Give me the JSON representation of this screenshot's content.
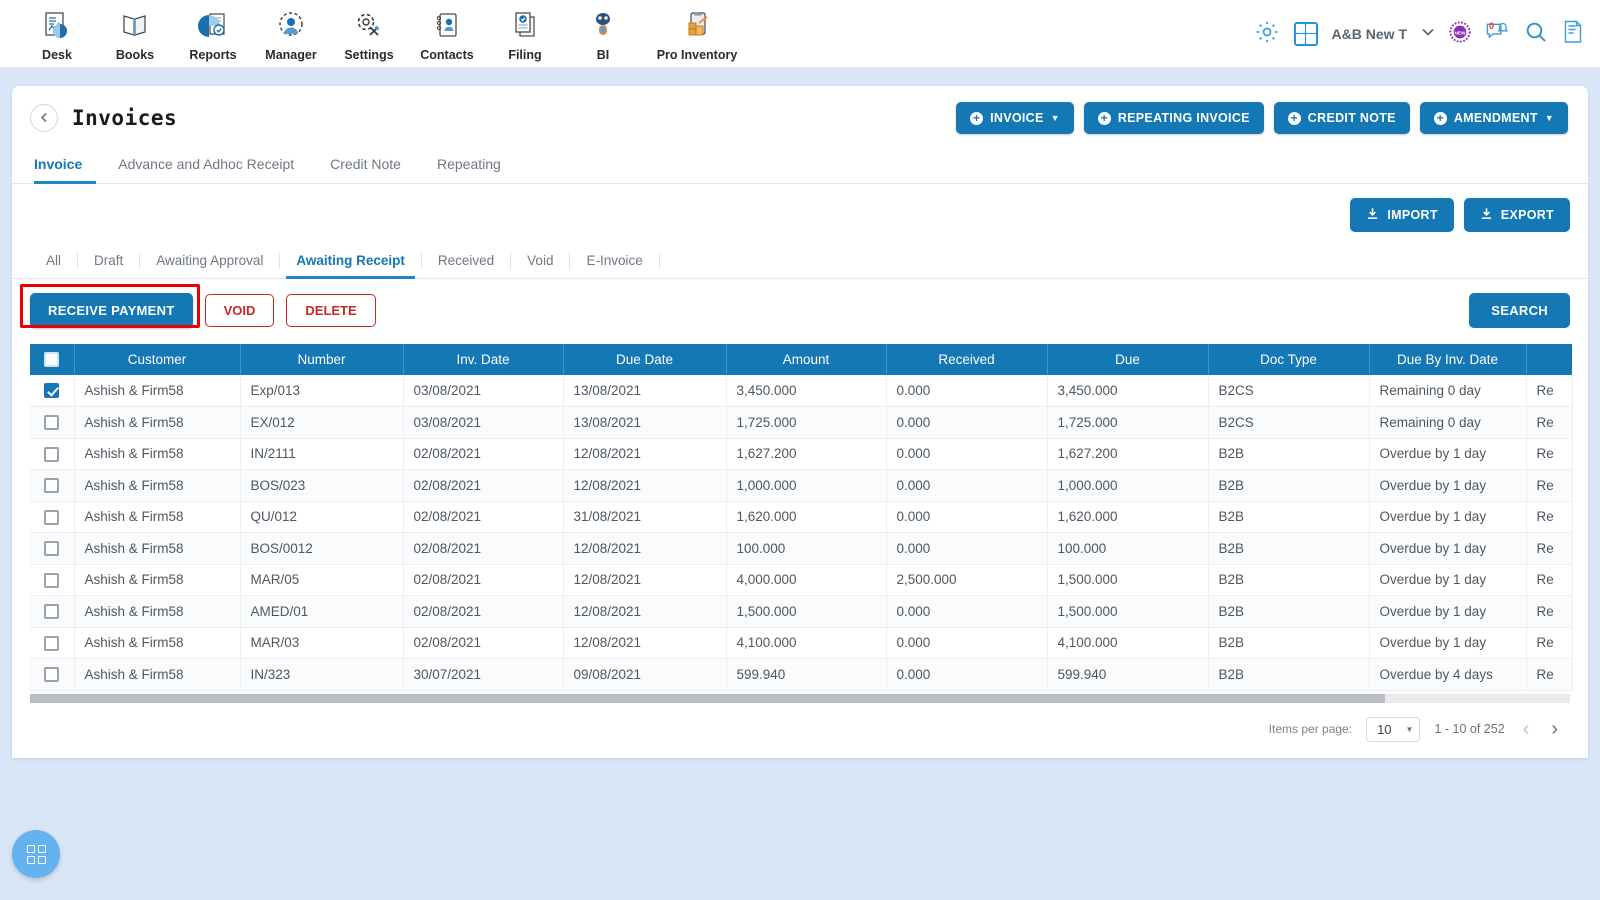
{
  "topnav": {
    "apps": [
      {
        "label": "Desk",
        "icon": "desk-icon"
      },
      {
        "label": "Books",
        "icon": "books-icon"
      },
      {
        "label": "Reports",
        "icon": "reports-icon"
      },
      {
        "label": "Manager",
        "icon": "manager-icon"
      },
      {
        "label": "Settings",
        "icon": "settings-icon"
      },
      {
        "label": "Contacts",
        "icon": "contacts-icon"
      },
      {
        "label": "Filing",
        "icon": "filing-icon"
      },
      {
        "label": "BI",
        "icon": "bi-icon"
      },
      {
        "label": "Pro Inventory",
        "icon": "pro-inventory-icon"
      }
    ],
    "org_name": "A&B New T",
    "notification_count": "0",
    "icons": [
      "gear-icon",
      "calculator-icon",
      "chevron-down-icon",
      "new-badge-icon",
      "notification-bell-icon",
      "search-icon",
      "document-icon"
    ]
  },
  "page": {
    "title": "Invoices",
    "back_icon": "chevron-left-icon"
  },
  "header_buttons": [
    {
      "label": "INVOICE",
      "has_caret": true
    },
    {
      "label": "REPEATING INVOICE",
      "has_caret": false
    },
    {
      "label": "CREDIT NOTE",
      "has_caret": false
    },
    {
      "label": "AMENDMENT",
      "has_caret": true
    }
  ],
  "main_tabs": [
    {
      "label": "Invoice",
      "active": true
    },
    {
      "label": "Advance and Adhoc Receipt",
      "active": false
    },
    {
      "label": "Credit Note",
      "active": false
    },
    {
      "label": "Repeating",
      "active": false
    }
  ],
  "io_buttons": [
    {
      "label": "IMPORT",
      "icon": "import-icon"
    },
    {
      "label": "EXPORT",
      "icon": "export-icon"
    }
  ],
  "filter_tabs": [
    {
      "label": "All",
      "active": false
    },
    {
      "label": "Draft",
      "active": false
    },
    {
      "label": "Awaiting Approval",
      "active": false
    },
    {
      "label": "Awaiting Receipt",
      "active": true
    },
    {
      "label": "Received",
      "active": false
    },
    {
      "label": "Void",
      "active": false
    },
    {
      "label": "E-Invoice",
      "active": false
    }
  ],
  "action_bar": {
    "receive_payment": "RECEIVE PAYMENT",
    "void": "VOID",
    "delete": "DELETE",
    "search": "SEARCH",
    "highlight_color": "#ea0000",
    "highlighted_element": "receive-payment-button"
  },
  "table": {
    "columns": [
      "Customer",
      "Number",
      "Inv. Date",
      "Due Date",
      "Amount",
      "Received",
      "Due",
      "Doc Type",
      "Due By Inv. Date",
      "Re"
    ],
    "rows": [
      {
        "checked": true,
        "customer": "Ashish & Firm58",
        "number": "Exp/013",
        "inv_date": "03/08/2021",
        "due_date": "13/08/2021",
        "amount": "3,450.000",
        "received": "0.000",
        "due": "3,450.000",
        "doc_type": "B2CS",
        "due_by": "Remaining 0 day",
        "due_by_state": "green",
        "last": "Re"
      },
      {
        "checked": false,
        "customer": "Ashish & Firm58",
        "number": "EX/012",
        "inv_date": "03/08/2021",
        "due_date": "13/08/2021",
        "amount": "1,725.000",
        "received": "0.000",
        "due": "1,725.000",
        "doc_type": "B2CS",
        "due_by": "Remaining 0 day",
        "due_by_state": "green",
        "last": "Re"
      },
      {
        "checked": false,
        "customer": "Ashish & Firm58",
        "number": "IN/2111",
        "inv_date": "02/08/2021",
        "due_date": "12/08/2021",
        "amount": "1,627.200",
        "received": "0.000",
        "due": "1,627.200",
        "doc_type": "B2B",
        "due_by": "Overdue by 1 day",
        "due_by_state": "red",
        "last": "Re"
      },
      {
        "checked": false,
        "customer": "Ashish & Firm58",
        "number": "BOS/023",
        "inv_date": "02/08/2021",
        "due_date": "12/08/2021",
        "amount": "1,000.000",
        "received": "0.000",
        "due": "1,000.000",
        "doc_type": "B2B",
        "due_by": "Overdue by 1 day",
        "due_by_state": "red",
        "last": "Re"
      },
      {
        "checked": false,
        "customer": "Ashish & Firm58",
        "number": "QU/012",
        "inv_date": "02/08/2021",
        "due_date": "31/08/2021",
        "amount": "1,620.000",
        "received": "0.000",
        "due": "1,620.000",
        "doc_type": "B2B",
        "due_by": "Overdue by 1 day",
        "due_by_state": "red",
        "last": "Re"
      },
      {
        "checked": false,
        "customer": "Ashish & Firm58",
        "number": "BOS/0012",
        "inv_date": "02/08/2021",
        "due_date": "12/08/2021",
        "amount": "100.000",
        "received": "0.000",
        "due": "100.000",
        "doc_type": "B2B",
        "due_by": "Overdue by 1 day",
        "due_by_state": "red",
        "last": "Re"
      },
      {
        "checked": false,
        "customer": "Ashish & Firm58",
        "number": "MAR/05",
        "inv_date": "02/08/2021",
        "due_date": "12/08/2021",
        "amount": "4,000.000",
        "received": "2,500.000",
        "due": "1,500.000",
        "doc_type": "B2B",
        "due_by": "Overdue by 1 day",
        "due_by_state": "red",
        "last": "Re"
      },
      {
        "checked": false,
        "customer": "Ashish & Firm58",
        "number": "AMED/01",
        "inv_date": "02/08/2021",
        "due_date": "12/08/2021",
        "amount": "1,500.000",
        "received": "0.000",
        "due": "1,500.000",
        "doc_type": "B2B",
        "due_by": "Overdue by 1 day",
        "due_by_state": "red",
        "last": "Re"
      },
      {
        "checked": false,
        "customer": "Ashish & Firm58",
        "number": "MAR/03",
        "inv_date": "02/08/2021",
        "due_date": "12/08/2021",
        "amount": "4,100.000",
        "received": "0.000",
        "due": "4,100.000",
        "doc_type": "B2B",
        "due_by": "Overdue by 1 day",
        "due_by_state": "red",
        "last": "Re"
      },
      {
        "checked": false,
        "customer": "Ashish & Firm58",
        "number": "IN/323",
        "inv_date": "30/07/2021",
        "due_date": "09/08/2021",
        "amount": "599.940",
        "received": "0.000",
        "due": "599.940",
        "doc_type": "B2B",
        "due_by": "Overdue by 4 days",
        "due_by_state": "red",
        "last": "Re"
      }
    ]
  },
  "paginator": {
    "items_per_page_label": "Items per page:",
    "items_per_page_value": "10",
    "range": "1 - 10 of 252",
    "prev_icon": "chevron-left-icon",
    "next_icon": "chevron-right-icon"
  },
  "fab": {
    "icon": "grid-apps-icon"
  },
  "colors": {
    "primary": "#1378b4",
    "page_bg": "#d9e6f7",
    "highlight": "#ea0000",
    "green": "#1f7a33",
    "red": "#dd3c3c"
  }
}
